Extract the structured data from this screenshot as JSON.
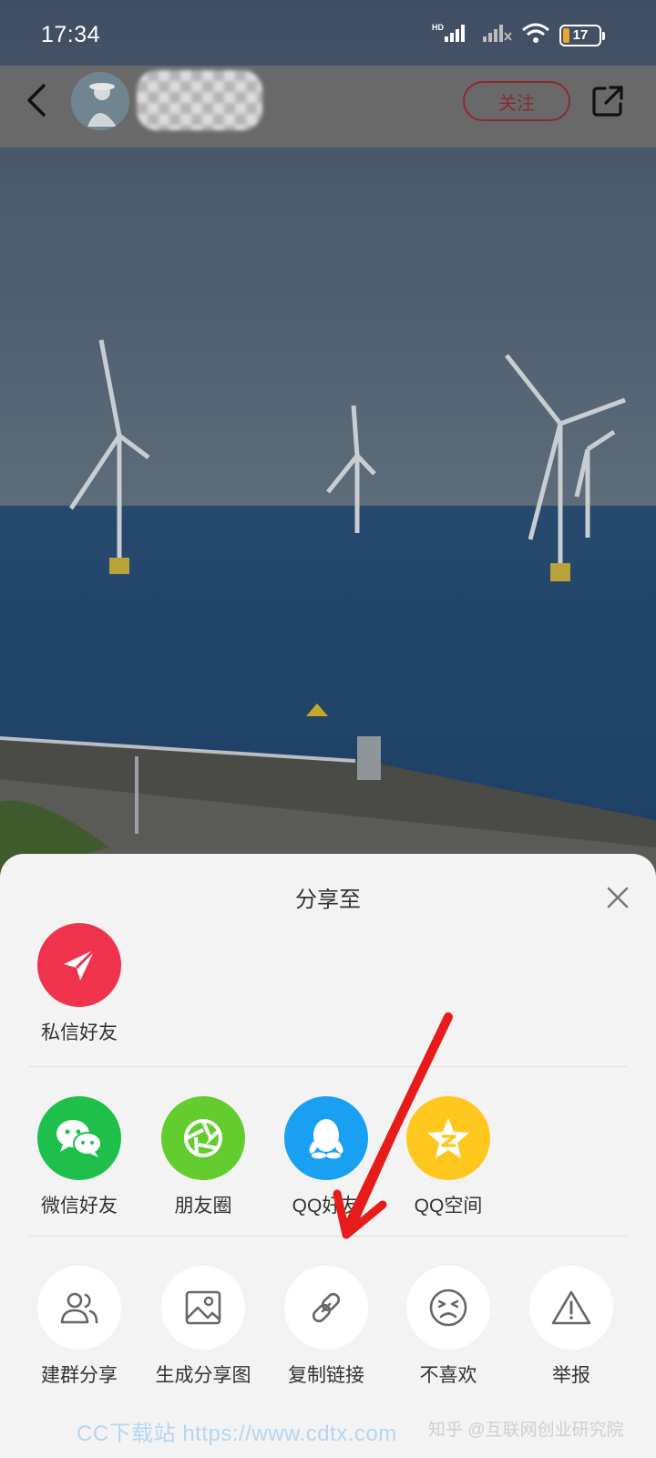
{
  "status_bar": {
    "time": "17:34",
    "battery_level": "17",
    "network": "HD",
    "icons": [
      "signal-icon",
      "signal-off-icon",
      "wifi-icon",
      "battery-icon"
    ]
  },
  "header": {
    "follow_label": "关注",
    "icons": [
      "back-arrow-icon",
      "share-out-icon"
    ]
  },
  "sheet": {
    "title": "分享至",
    "row1": [
      {
        "label": "私信好友",
        "icon": "paper-plane-icon",
        "color": "#f0334d"
      }
    ],
    "row2": [
      {
        "label": "微信好友",
        "icon": "wechat-icon",
        "color": "#1fbf4c"
      },
      {
        "label": "朋友圈",
        "icon": "shutter-icon",
        "color": "#63cc2e"
      },
      {
        "label": "QQ好友",
        "icon": "penguin-icon",
        "color": "#1aa0f2"
      },
      {
        "label": "QQ空间",
        "icon": "star-icon",
        "color": "#ffc81f"
      }
    ],
    "row3": [
      {
        "label": "建群分享",
        "icon": "group-icon"
      },
      {
        "label": "生成分享图",
        "icon": "image-icon"
      },
      {
        "label": "复制链接",
        "icon": "link-icon"
      },
      {
        "label": "不喜欢",
        "icon": "dislike-face-icon"
      },
      {
        "label": "举报",
        "icon": "warning-icon"
      }
    ]
  },
  "watermark": {
    "site": "CC下载站  https://www.cdtx.com",
    "credit": "知乎 @互联网创业研究院"
  }
}
